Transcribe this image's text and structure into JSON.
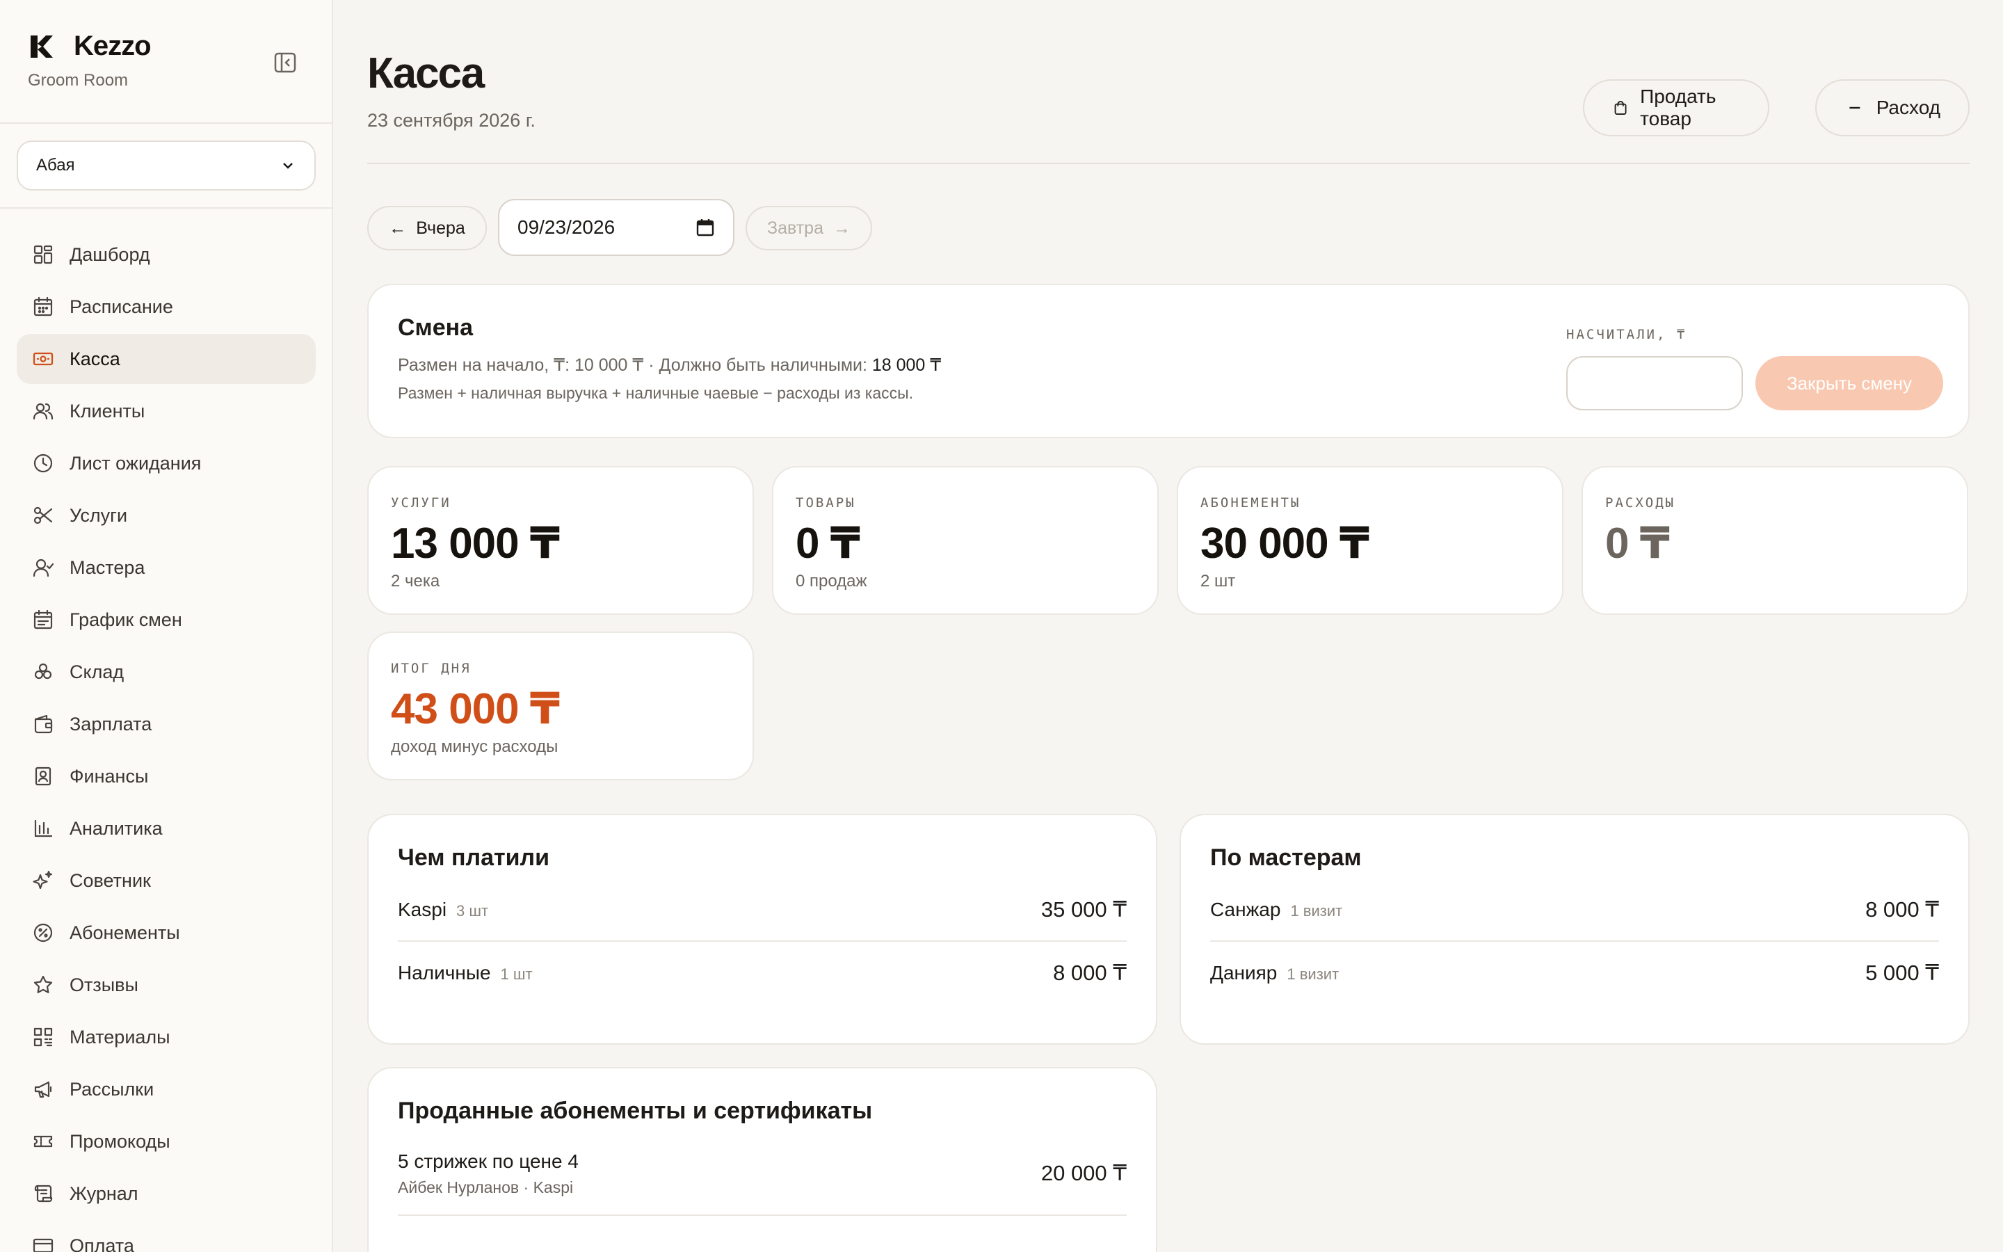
{
  "brand": {
    "name": "Kezzo",
    "subtitle": "Groom Room"
  },
  "branch": {
    "selected": "Абая"
  },
  "nav": [
    {
      "label": "Дашборд",
      "icon": "dashboard-icon",
      "active": false
    },
    {
      "label": "Расписание",
      "icon": "calendar-icon",
      "active": false
    },
    {
      "label": "Касса",
      "icon": "cash-icon",
      "active": true
    },
    {
      "label": "Клиенты",
      "icon": "users-icon",
      "active": false
    },
    {
      "label": "Лист ожидания",
      "icon": "clock-icon",
      "active": false
    },
    {
      "label": "Услуги",
      "icon": "scissors-icon",
      "active": false
    },
    {
      "label": "Мастера",
      "icon": "masters-icon",
      "active": false
    },
    {
      "label": "График смен",
      "icon": "schedule-icon",
      "active": false
    },
    {
      "label": "Склад",
      "icon": "warehouse-icon",
      "active": false
    },
    {
      "label": "Зарплата",
      "icon": "wallet-icon",
      "active": false
    },
    {
      "label": "Финансы",
      "icon": "finance-icon",
      "active": false
    },
    {
      "label": "Аналитика",
      "icon": "chart-icon",
      "active": false
    },
    {
      "label": "Советник",
      "icon": "sparkle-icon",
      "active": false
    },
    {
      "label": "Абонементы",
      "icon": "percent-badge-icon",
      "active": false
    },
    {
      "label": "Отзывы",
      "icon": "star-icon",
      "active": false
    },
    {
      "label": "Материалы",
      "icon": "qr-icon",
      "active": false
    },
    {
      "label": "Рассылки",
      "icon": "megaphone-icon",
      "active": false
    },
    {
      "label": "Промокоды",
      "icon": "ticket-icon",
      "active": false
    },
    {
      "label": "Журнал",
      "icon": "scroll-icon",
      "active": false
    },
    {
      "label": "Оплата",
      "icon": "card-icon",
      "active": false
    }
  ],
  "header": {
    "title": "Касса",
    "date": "23 сентября 2026 г.",
    "sell_label": "Продать товар",
    "expense_label": "Расход"
  },
  "datenav": {
    "prev_label": "Вчера",
    "date_value": "09/23/2026",
    "next_label": "Завтра"
  },
  "shift": {
    "title": "Смена",
    "line1_prefix": "Размен на начало, ₸: 10 000 ₸ · Должно быть наличными: ",
    "line1_value": "18 000 ₸",
    "line2": "Размен + наличная выручка + наличные чаевые − расходы из кассы.",
    "counted_label": "НАСЧИТАЛИ, ₸",
    "counted_value": "",
    "close_label": "Закрыть смену"
  },
  "stats": [
    {
      "label": "УСЛУГИ",
      "value": "13 000 ₸",
      "sub": "2 чека"
    },
    {
      "label": "ТОВАРЫ",
      "value": "0 ₸",
      "sub": "0 продаж"
    },
    {
      "label": "АБОНЕМЕНТЫ",
      "value": "30 000 ₸",
      "sub": "2 шт"
    },
    {
      "label": "РАСХОДЫ",
      "value": "0 ₸",
      "sub": ""
    },
    {
      "label": "ИТОГ ДНЯ",
      "value": "43 000 ₸",
      "sub": "доход минус расходы"
    }
  ],
  "payments": {
    "title": "Чем платили",
    "rows": [
      {
        "name": "Kaspi",
        "meta": "3 шт",
        "amount": "35 000 ₸"
      },
      {
        "name": "Наличные",
        "meta": "1 шт",
        "amount": "8 000 ₸"
      }
    ]
  },
  "masters": {
    "title": "По мастерам",
    "rows": [
      {
        "name": "Санжар",
        "meta": "1 визит",
        "amount": "8 000 ₸"
      },
      {
        "name": "Данияр",
        "meta": "1 визит",
        "amount": "5 000 ₸"
      }
    ]
  },
  "subscriptions": {
    "title": "Проданные абонементы и сертификаты",
    "rows": [
      {
        "name": "5 стрижек по цене 4",
        "meta": "Айбек Нурланов · Kaspi",
        "amount": "20 000 ₸"
      }
    ]
  },
  "colors": {
    "accent": "#d04e17",
    "close_button": "#f9c8b1",
    "background": "#f7f5f1"
  }
}
